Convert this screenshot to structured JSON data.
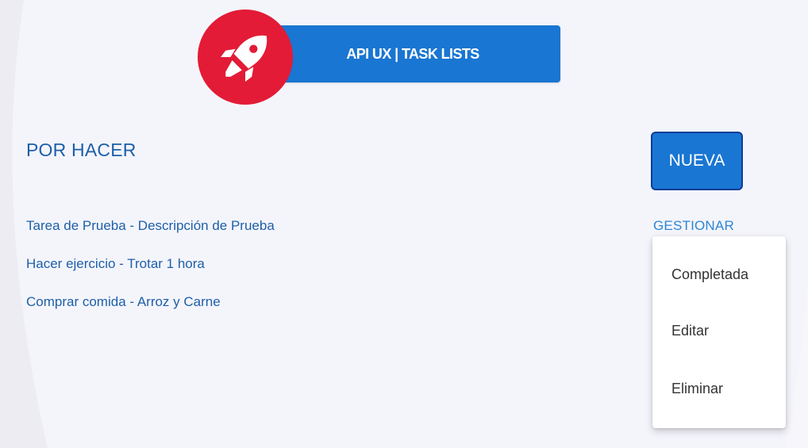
{
  "header": {
    "title": "API UX | TASK LISTS",
    "logo_icon": "rocket-icon",
    "logo_color": "#e31b36",
    "banner_color": "#1976d2"
  },
  "section": {
    "title": "POR HACER"
  },
  "actions": {
    "new_label": "NUEVA",
    "manage_label": "GESTIONAR"
  },
  "tasks": [
    "Tarea de Prueba - Descripción de Prueba",
    "Hacer ejercicio - Trotar 1 hora",
    "Comprar comida - Arroz y Carne"
  ],
  "menu": {
    "items": [
      "Completada",
      "Editar",
      "Eliminar"
    ]
  }
}
